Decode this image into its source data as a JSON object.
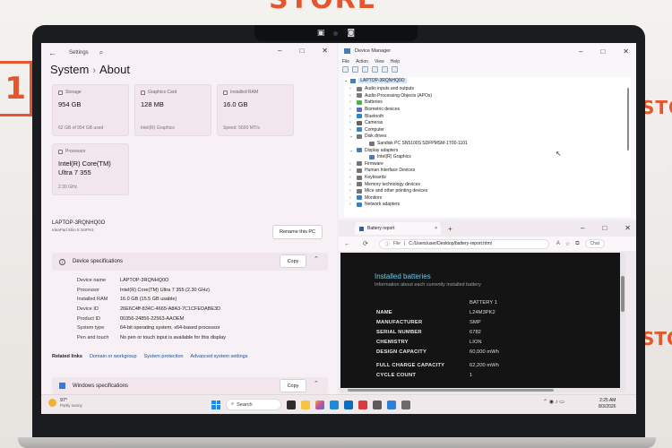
{
  "backdrop": {
    "sign_top": "STORE",
    "sign_left": "1",
    "sign_right": "STORE",
    "sign_right_bottom": "STORE"
  },
  "settings": {
    "app_title": "Settings",
    "breadcrumb": {
      "parent": "System",
      "separator": "›",
      "current": "About"
    },
    "cards": {
      "storage": {
        "caption": "Storage",
        "value": "954 GB",
        "detail": "62 GB of 954 GB used"
      },
      "graphics": {
        "caption": "Graphics Card",
        "value": "128 MB",
        "detail": "Intel(R) Graphics"
      },
      "ram": {
        "caption": "Installed RAM",
        "value": "16.0 GB",
        "detail": "Speed: 5600 MT/s"
      },
      "processor": {
        "caption": "Processor",
        "value": "Intel(R) Core(TM) Ultra 7 355",
        "detail": "2.30 GHz"
      }
    },
    "device": {
      "name": "LAPTOP-3RQNHQ0O",
      "model": "IdeaPad Slim 5 16IPH1",
      "rename_label": "Rename this PC"
    },
    "device_specs": {
      "heading": "Device specifications",
      "copy_label": "Copy",
      "rows": [
        {
          "key": "Device name",
          "value": "LAPTOP-3RQNHQ0O"
        },
        {
          "key": "Processor",
          "value": "Intel(R) Core(TM) Ultra 7 355 (2.30 GHz)"
        },
        {
          "key": "Installed RAM",
          "value": "16.0 GB (15.5 GB usable)"
        },
        {
          "key": "Device ID",
          "value": "26E6C4ff-834C-4665-A8A3-7C1CFEDABE3D"
        },
        {
          "key": "Product ID",
          "value": "00356-24856-22563-AAOEM"
        },
        {
          "key": "System type",
          "value": "64-bit operating system, x64-based processor"
        },
        {
          "key": "Pen and touch",
          "value": "No pen or touch input is available for this display"
        }
      ]
    },
    "related": {
      "label": "Related links",
      "links": [
        "Domain or workgroup",
        "System protection",
        "Advanced system settings"
      ]
    },
    "windows_specs": {
      "heading": "Windows specifications",
      "copy_label": "Copy"
    }
  },
  "device_manager": {
    "title": "Device Manager",
    "menu": [
      "File",
      "Action",
      "View",
      "Help"
    ],
    "root": "LAPTOP-3RQNHQ0O",
    "items": [
      {
        "label": "Audio inputs and outputs",
        "color": "#7a7a7a",
        "arrow": "›",
        "indent": 0
      },
      {
        "label": "Audio Processing Objects (APOs)",
        "color": "#7a7a7a",
        "arrow": "›",
        "indent": 0
      },
      {
        "label": "Batteries",
        "color": "#4caf50",
        "arrow": "›",
        "indent": 0
      },
      {
        "label": "Biometric devices",
        "color": "#5c6bc0",
        "arrow": "›",
        "indent": 0
      },
      {
        "label": "Bluetooth",
        "color": "#1e88e5",
        "arrow": "›",
        "indent": 0
      },
      {
        "label": "Cameras",
        "color": "#616161",
        "arrow": "›",
        "indent": 0
      },
      {
        "label": "Computer",
        "color": "#4a7fb5",
        "arrow": "›",
        "indent": 0
      },
      {
        "label": "Disk drives",
        "color": "#757575",
        "arrow": "⌄",
        "indent": 0
      },
      {
        "label": "Sandisk PC SN5100S SDFPMSM-1T00-1101",
        "color": "#757575",
        "arrow": "",
        "indent": 1
      },
      {
        "label": "Display adapters",
        "color": "#3f7fbf",
        "arrow": "⌄",
        "indent": 0
      },
      {
        "label": "Intel(R) Graphics",
        "color": "#3f7fbf",
        "arrow": "",
        "indent": 1
      },
      {
        "label": "Firmware",
        "color": "#757575",
        "arrow": "›",
        "indent": 0
      },
      {
        "label": "Human Interface Devices",
        "color": "#757575",
        "arrow": "›",
        "indent": 0
      },
      {
        "label": "Keyboards",
        "color": "#757575",
        "arrow": "›",
        "indent": 0
      },
      {
        "label": "Memory technology devices",
        "color": "#757575",
        "arrow": "›",
        "indent": 0
      },
      {
        "label": "Mice and other pointing devices",
        "color": "#757575",
        "arrow": "›",
        "indent": 0
      },
      {
        "label": "Monitors",
        "color": "#3f7fbf",
        "arrow": "›",
        "indent": 0
      },
      {
        "label": "Network adapters",
        "color": "#3f7fbf",
        "arrow": "›",
        "indent": 0
      }
    ]
  },
  "browser": {
    "tab_title": "Battery report",
    "tab_close": "×",
    "new_tab": "+",
    "nav": "← ⟳",
    "address_label": "File",
    "address_url": "C:/Users/user/Desktop/battery-report.html",
    "zoom_icon": "A",
    "star_icon": "☆",
    "chat_label": "Chat",
    "report": {
      "title": "Installed batteries",
      "subtitle": "Information about each currently installed battery",
      "battery_header": "BATTERY 1",
      "rows": [
        {
          "key": "NAME",
          "value": "L24M3PK2"
        },
        {
          "key": "MANUFACTURER",
          "value": "SMP"
        },
        {
          "key": "SERIAL NUMBER",
          "value": "6782"
        },
        {
          "key": "CHEMISTRY",
          "value": "LION"
        },
        {
          "key": "DESIGN CAPACITY",
          "value": "60,000 mWh"
        },
        {
          "key": "FULL CHARGE CAPACITY",
          "value": "62,200 mWh"
        },
        {
          "key": "CYCLE COUNT",
          "value": "1"
        }
      ]
    }
  },
  "taskbar": {
    "temperature": "97°",
    "condition": "Partly sunny",
    "search_label": "Search",
    "time": "2:25 AM",
    "date": "8/3/2026",
    "tray_glyphs": "⌃ ◉ ♪ ▭"
  }
}
